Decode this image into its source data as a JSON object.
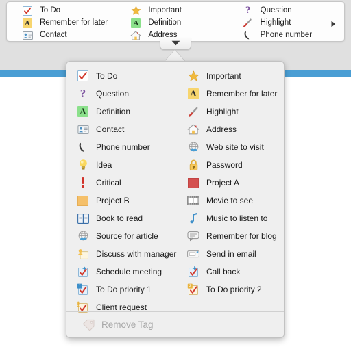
{
  "toolbar": {
    "columns": [
      [
        {
          "label": "To Do",
          "icon": "checkbox-checked-icon"
        },
        {
          "label": "Remember for later",
          "icon": "letter-a-yellow-icon"
        },
        {
          "label": "Contact",
          "icon": "contact-card-icon"
        }
      ],
      [
        {
          "label": "Important",
          "icon": "star-icon"
        },
        {
          "label": "Definition",
          "icon": "letter-a-green-icon"
        },
        {
          "label": "Address",
          "icon": "house-icon"
        }
      ],
      [
        {
          "label": "Question",
          "icon": "question-mark-icon"
        },
        {
          "label": "Highlight",
          "icon": "pen-icon"
        },
        {
          "label": "Phone number",
          "icon": "phone-icon"
        }
      ]
    ],
    "overflow_icon": "triangle-right-icon",
    "disclosure_icon": "triangle-down-icon"
  },
  "popup": {
    "items": [
      {
        "label": "To Do",
        "icon": "checkbox-checked-icon"
      },
      {
        "label": "Important",
        "icon": "star-icon"
      },
      {
        "label": "Question",
        "icon": "question-mark-icon"
      },
      {
        "label": "Remember for later",
        "icon": "letter-a-yellow-icon"
      },
      {
        "label": "Definition",
        "icon": "letter-a-green-icon"
      },
      {
        "label": "Highlight",
        "icon": "pen-icon"
      },
      {
        "label": "Contact",
        "icon": "contact-card-icon"
      },
      {
        "label": "Address",
        "icon": "house-icon"
      },
      {
        "label": "Phone number",
        "icon": "phone-icon"
      },
      {
        "label": "Web site to visit",
        "icon": "globe-icon"
      },
      {
        "label": "Idea",
        "icon": "lightbulb-icon"
      },
      {
        "label": "Password",
        "icon": "lock-icon"
      },
      {
        "label": "Critical",
        "icon": "exclamation-icon"
      },
      {
        "label": "Project A",
        "icon": "red-swatch-icon"
      },
      {
        "label": "Project B",
        "icon": "orange-swatch-icon"
      },
      {
        "label": "Movie to see",
        "icon": "film-strip-icon"
      },
      {
        "label": "Book to read",
        "icon": "book-icon"
      },
      {
        "label": "Music to listen to",
        "icon": "music-note-icon"
      },
      {
        "label": "Source for article",
        "icon": "globe-icon"
      },
      {
        "label": "Remember for blog",
        "icon": "speech-bubble-icon"
      },
      {
        "label": "Discuss with manager",
        "icon": "person-note-icon"
      },
      {
        "label": "Send in email",
        "icon": "envelope-icon"
      },
      {
        "label": "Schedule meeting",
        "icon": "checkbox-arrow-icon"
      },
      {
        "label": "Call back",
        "icon": "checkbox-arrow-icon"
      },
      {
        "label": "To Do priority 1",
        "icon": "checkbox-one-icon"
      },
      {
        "label": "To Do priority 2",
        "icon": "checkbox-two-icon"
      },
      {
        "label": "Client request",
        "icon": "checkbox-bang-icon"
      }
    ],
    "remove_tag": {
      "label": "Remove Tag",
      "icon": "tag-remove-icon",
      "disabled": true
    }
  },
  "colors": {
    "accent_blue": "#4a9ed4",
    "toolbar_bg": "#e0e0e0",
    "popup_bg": "#efefef",
    "check_red": "#d23b2e",
    "yellow": "#f7d56e",
    "green": "#8be08b",
    "project_a_red": "#d4504f",
    "project_b_orange": "#f5c06a",
    "purple": "#7a4f9e",
    "disabled_text": "#a8a8a8"
  }
}
